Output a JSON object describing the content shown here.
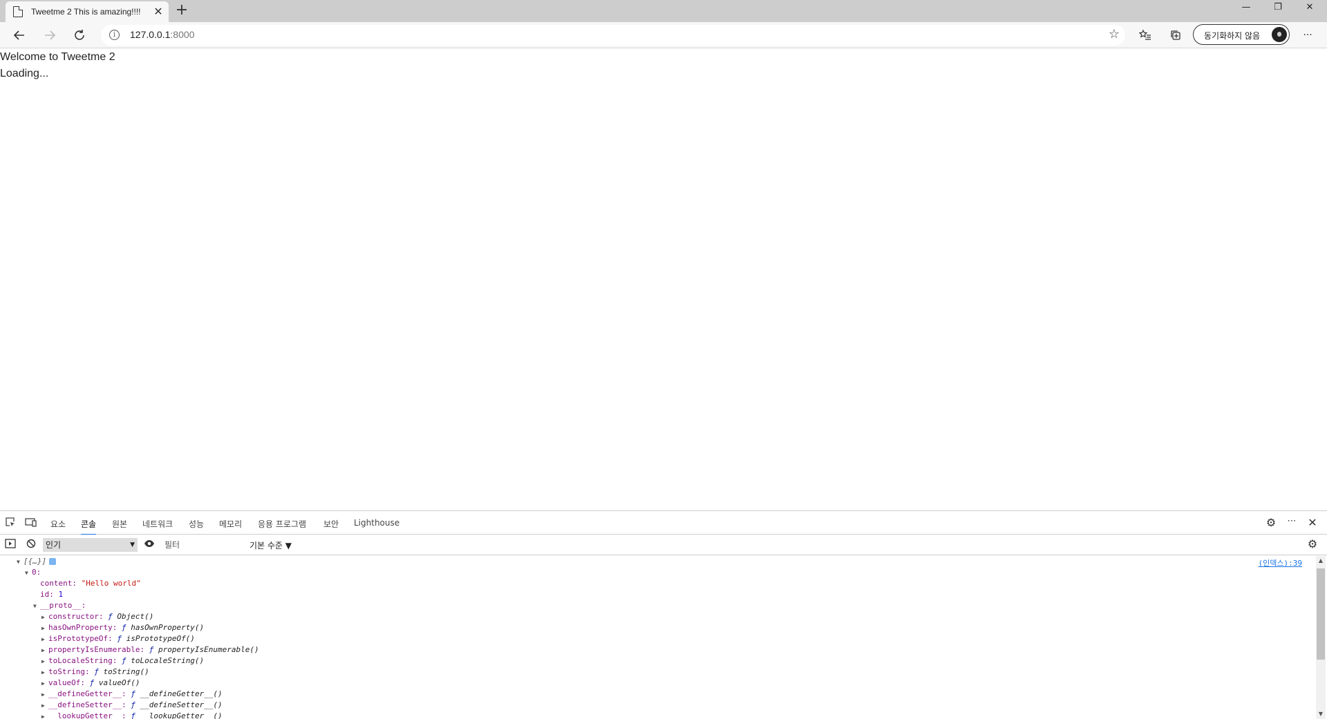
{
  "browser": {
    "tab_title": "Tweetme 2 This is amazing!!!!",
    "tab_close": "✕",
    "new_tab": "+",
    "address_host": "127.0.0.1",
    "address_port": ":8000",
    "sync_label": "동기화하지 않음",
    "window_minimize": "—",
    "window_restore": "❐",
    "window_close": "✕",
    "menu": "···"
  },
  "page": {
    "welcome": "Welcome to Tweetme 2",
    "loading": "Loading..."
  },
  "devtools": {
    "tabs": [
      {
        "label": "요소"
      },
      {
        "label": "콘솔"
      },
      {
        "label": "원본"
      },
      {
        "label": "네트워크"
      },
      {
        "label": "성능"
      },
      {
        "label": "메모리"
      },
      {
        "label": "응용 프로그램"
      },
      {
        "label": "보안"
      },
      {
        "label": "Lighthouse"
      }
    ],
    "active_tab": "콘솔",
    "context": "인기",
    "filter_placeholder": "필터",
    "levels": "기본 수준 ▼",
    "source_link": "(인덱스):39",
    "console_lines": {
      "root": "[{…}]",
      "item0": "0:",
      "content_key": "content:",
      "content_val": "\"Hello world\"",
      "id_key": "id:",
      "id_val": "1",
      "proto_key": "__proto__:",
      "props": [
        {
          "key": "constructor:",
          "sig": "Object()"
        },
        {
          "key": "hasOwnProperty:",
          "sig": "hasOwnProperty()"
        },
        {
          "key": "isPrototypeOf:",
          "sig": "isPrototypeOf()"
        },
        {
          "key": "propertyIsEnumerable:",
          "sig": "propertyIsEnumerable()"
        },
        {
          "key": "toLocaleString:",
          "sig": "toLocaleString()"
        },
        {
          "key": "toString:",
          "sig": "toString()"
        },
        {
          "key": "valueOf:",
          "sig": "valueOf()"
        },
        {
          "key": "__defineGetter__:",
          "sig": "__defineGetter__()"
        },
        {
          "key": "__defineSetter__:",
          "sig": "__defineSetter__()"
        },
        {
          "key": "__lookupGetter__:",
          "sig": "__lookupGetter__()"
        }
      ],
      "f_glyph": "ƒ"
    }
  }
}
